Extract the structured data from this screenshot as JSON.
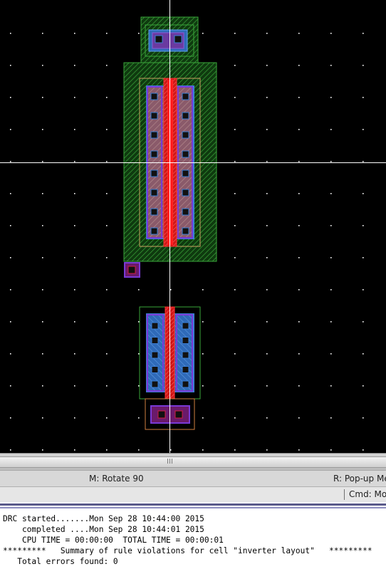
{
  "window": {
    "width": 542,
    "height": 799
  },
  "canvas": {
    "background": "#000000",
    "colors": {
      "nwell": "#3aa63a",
      "active": "#3a7fd6",
      "poly": "#e02020",
      "metal": "#7a3ad6",
      "contact": "#111111",
      "select_outline": "#c8a060",
      "nselect": "#d08040",
      "crosshair": "#ffffff",
      "grid_dot": "#ffffff"
    }
  },
  "statusbar": {
    "middle_mouse": "M: Rotate 90",
    "right_mouse": "R: Pop-up Me"
  },
  "cmdbar": {
    "label": "Cmd: Mo"
  },
  "log": {
    "lines": [
      "DRC started.......Mon Sep 28 10:44:00 2015",
      "    completed ....Mon Sep 28 10:44:01 2015",
      "    CPU TIME = 00:00:00  TOTAL TIME = 00:00:01",
      "*********   Summary of rule violations for cell \"inverter layout\"   *********",
      "   Total errors found: 0"
    ]
  }
}
